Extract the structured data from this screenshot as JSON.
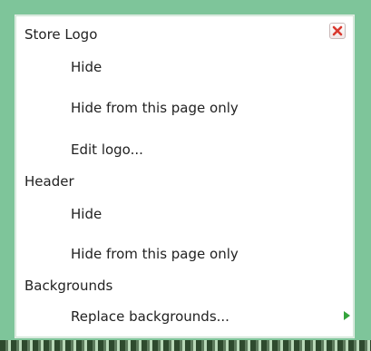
{
  "menu": {
    "sections": [
      {
        "title": "Store Logo",
        "items": [
          "Hide",
          "Hide from this page only",
          "Edit logo..."
        ]
      },
      {
        "title": "Header",
        "items": [
          "Hide",
          "Hide from this page only"
        ]
      },
      {
        "title": "Backgrounds",
        "items": [
          "Replace backgrounds..."
        ]
      }
    ],
    "close_icon": "close-icon",
    "submenu_icon": "submenu-arrow-icon",
    "colors": {
      "frame": "#7ec59a",
      "panel": "#ffffff",
      "close_x": "#d9392f",
      "arrow": "#35a43c"
    }
  }
}
